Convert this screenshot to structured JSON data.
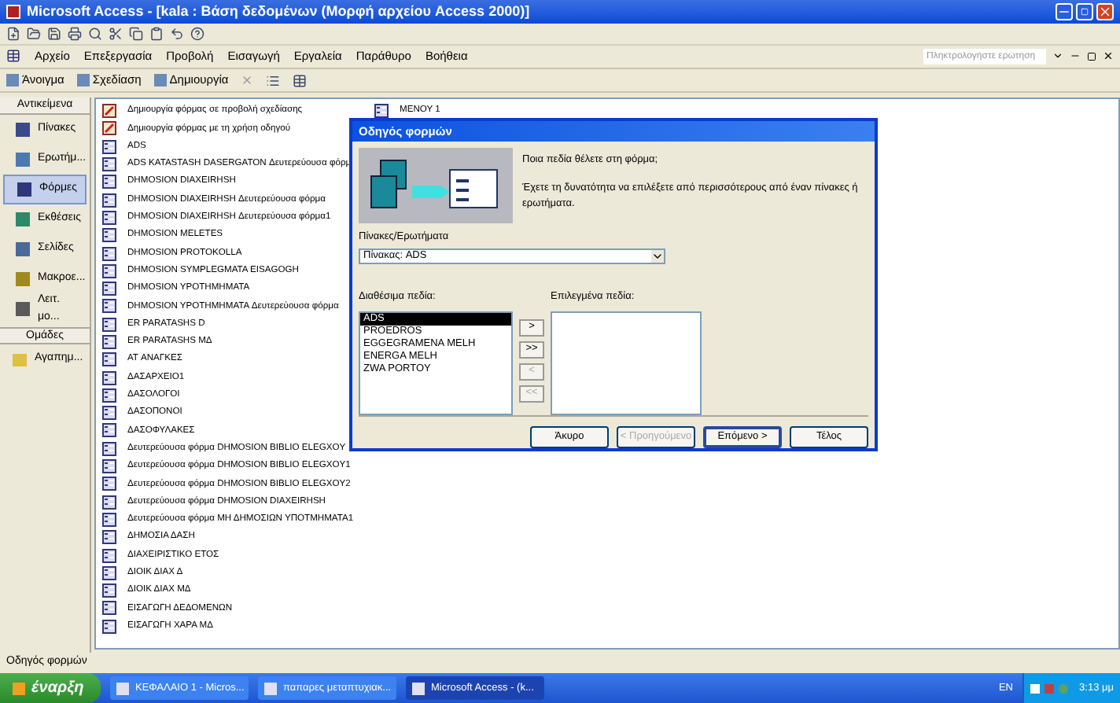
{
  "window": {
    "title": "Microsoft Access - [kala : Βάση δεδομένων (Μορφή αρχείου Access 2000)]"
  },
  "menu": [
    "Αρχείο",
    "Επεξεργασία",
    "Προβολή",
    "Εισαγωγή",
    "Εργαλεία",
    "Παράθυρο",
    "Βοήθεια"
  ],
  "help_box": {
    "placeholder": "Πληκτρολογήστε ερώτηση"
  },
  "db_toolbar": [
    "Άνοιγμα",
    "Σχεδίαση",
    "Δημιουργία"
  ],
  "sidebar": {
    "objects_header": "Αντικείμενα",
    "items": [
      {
        "label": "Πίνακες",
        "selected": false,
        "kind": "table"
      },
      {
        "label": "Ερωτήμ...",
        "selected": false,
        "kind": "query"
      },
      {
        "label": "Φόρμες",
        "selected": true,
        "kind": "form"
      },
      {
        "label": "Εκθέσεις",
        "selected": false,
        "kind": "report"
      },
      {
        "label": "Σελίδες",
        "selected": false,
        "kind": "page"
      },
      {
        "label": "Μακροε...",
        "selected": false,
        "kind": "macro"
      },
      {
        "label": "Λειτ. μο...",
        "selected": false,
        "kind": "module"
      }
    ],
    "groups_header": "Ομάδες",
    "groups": [
      {
        "label": "Αγαπημ...",
        "selected": false
      }
    ]
  },
  "columns": [
    [
      {
        "label": "Δημιουργία φόρμας σε προβολή σχεδίασης",
        "kind": "wizard"
      },
      {
        "label": "Δημιουργία φόρμας με τη χρήση οδηγού",
        "kind": "wizard"
      },
      {
        "label": "ADS",
        "kind": "form"
      },
      {
        "label": "ADS KATASTASH DASERGATON Δευτερεύουσα φόρμ",
        "kind": "form"
      },
      {
        "label": "DHMOSION DIAXEIRHSH",
        "kind": "form"
      },
      {
        "label": "DHMOSION DIAXEIRHSH Δευτερεύουσα φόρμα",
        "kind": "form"
      },
      {
        "label": "DHMOSION DIAXEIRHSH Δευτερεύουσα φόρμα1",
        "kind": "form"
      },
      {
        "label": "DHMOSION MELETES",
        "kind": "form"
      },
      {
        "label": "DHMOSION PROTOKOLLA",
        "kind": "form"
      },
      {
        "label": "DHMOSION SYMPLEGMATA EISAGOGH",
        "kind": "form"
      },
      {
        "label": "DHMOSION YPOTHMHMATA",
        "kind": "form"
      },
      {
        "label": "DHMOSION YPOTHMHMATA Δευτερεύουσα φόρμα",
        "kind": "form"
      },
      {
        "label": "ER PARATASHS D",
        "kind": "form"
      },
      {
        "label": "ER PARATASHS ΜΔ",
        "kind": "form"
      },
      {
        "label": "AT ΑΝΑΓΚΕΣ",
        "kind": "form"
      },
      {
        "label": "ΔΑΣΑΡΧΕΙΟ1",
        "kind": "form"
      },
      {
        "label": "ΔΑΣΟΛΟΓΟΙ",
        "kind": "form"
      },
      {
        "label": "ΔΑΣΟΠΟΝΟΙ",
        "kind": "form"
      },
      {
        "label": "ΔΑΣΟΦΥΛΑΚΕΣ",
        "kind": "form"
      },
      {
        "label": "Δευτερεύουσα φόρμα DHMOSION BIBLIO ELEGXOY",
        "kind": "form"
      },
      {
        "label": "Δευτερεύουσα φόρμα DHMOSION BIBLIO ELEGXOY1",
        "kind": "form"
      },
      {
        "label": "Δευτερεύουσα φόρμα DHMOSION BIBLIO ELEGXOY2",
        "kind": "form"
      },
      {
        "label": "Δευτερεύουσα φόρμα DHMOSION DIAXEIRHSH",
        "kind": "form"
      },
      {
        "label": "Δευτερεύουσα φόρμα ΜΗ ΔΗΜΟΣΙΩΝ ΥΠΟΤΜΗΜΑΤΑ1",
        "kind": "form"
      },
      {
        "label": "ΔΗΜΟΣΙΑ ΔΑΣΗ",
        "kind": "form"
      },
      {
        "label": "ΔΙΑΧΕΙΡΙΣΤΙΚΟ ΕΤΟΣ",
        "kind": "form"
      },
      {
        "label": "ΔΙΟΙΚ ΔΙΑΧ Δ",
        "kind": "form"
      },
      {
        "label": "ΔΙΟΙΚ ΔΙΑΧ ΜΔ",
        "kind": "form"
      },
      {
        "label": "ΕΙΣΑΓΩΓΗ ΔΕΔΟΜΕΝΩΝ",
        "kind": "form"
      },
      {
        "label": "ΕΙΣΑΓΩΓΗ ΧΑΡΑ ΜΔ",
        "kind": "form"
      }
    ],
    [
      {
        "label": "ΜΕΝΟΥ 1",
        "kind": "form"
      }
    ]
  ],
  "dialog": {
    "title": "Οδηγός φορμών",
    "question": "Ποια πεδία θέλετε στη φόρμα;",
    "hint": "Έχετε τη δυνατότητα να επιλέξετε από περισσότερους από έναν πίνακες ή ερωτήματα.",
    "source_label": "Πίνακες/Ερωτήματα",
    "source_value": "Πίνακας: ADS",
    "available_label": "Διαθέσιμα πεδία:",
    "selected_label": "Επιλεγμένα πεδία:",
    "available": [
      {
        "label": "ADS",
        "selected": true
      },
      {
        "label": "PROEDROS",
        "selected": false
      },
      {
        "label": "EGGEGRAMENA MELH",
        "selected": false
      },
      {
        "label": "ENERGA MELH",
        "selected": false
      },
      {
        "label": "ZWA PORTOY",
        "selected": false
      }
    ],
    "move_buttons": [
      {
        "label": ">",
        "disabled": false
      },
      {
        "label": ">>",
        "disabled": false
      },
      {
        "label": "<",
        "disabled": true
      },
      {
        "label": "<<",
        "disabled": true
      }
    ],
    "buttons": [
      {
        "label": "Άκυρο",
        "disabled": false,
        "default": false
      },
      {
        "label": "< Προηγούμενο",
        "disabled": true,
        "default": false
      },
      {
        "label": "Επόμενο >",
        "disabled": false,
        "default": true
      },
      {
        "label": "Τέλος",
        "disabled": false,
        "default": false
      }
    ]
  },
  "status_bar": "Οδηγός φορμών",
  "taskbar": {
    "start": "έναρξη",
    "tasks": [
      {
        "label": "ΚΕΦΑΛΑΙΟ 1 - Micros...",
        "selected": false
      },
      {
        "label": "παπαρες μεταπτυχιακ...",
        "selected": false
      },
      {
        "label": "Microsoft Access - (k...",
        "selected": true
      }
    ],
    "language": "EN",
    "clock": "3:13 μμ"
  }
}
